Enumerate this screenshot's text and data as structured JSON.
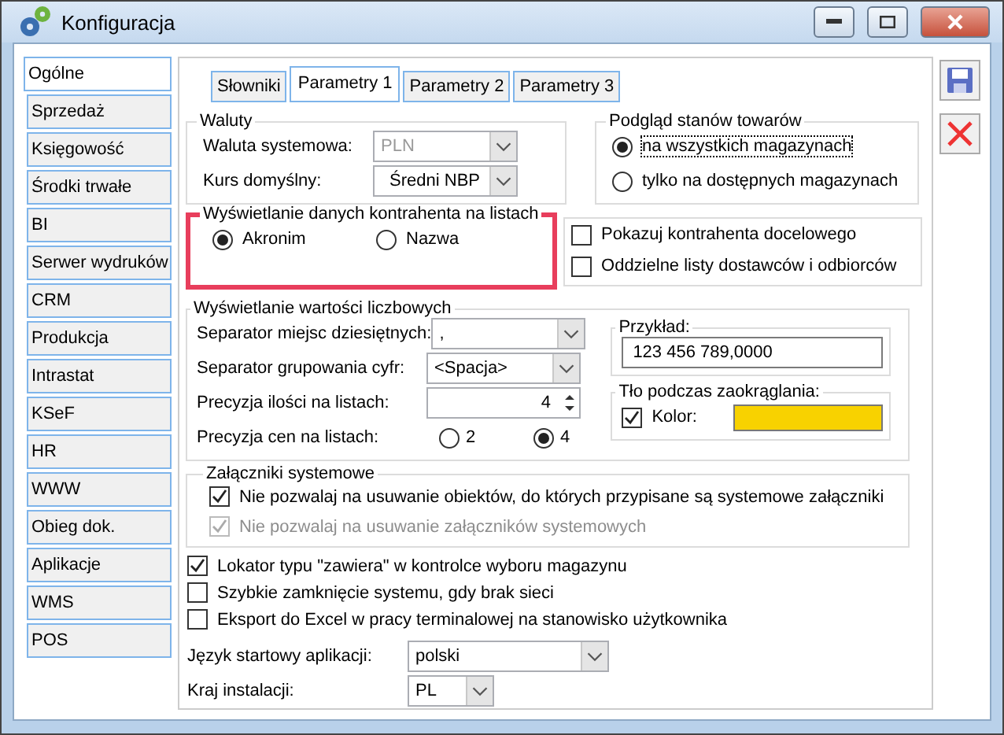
{
  "window": {
    "title": "Konfiguracja"
  },
  "sidebar": {
    "items": [
      {
        "label": "Ogólne",
        "selected": true
      },
      {
        "label": "Sprzedaż",
        "selected": false
      },
      {
        "label": "Księgowość",
        "selected": false
      },
      {
        "label": "Środki trwałe",
        "selected": false
      },
      {
        "label": "BI",
        "selected": false
      },
      {
        "label": "Serwer wydruków",
        "selected": false
      },
      {
        "label": "CRM",
        "selected": false
      },
      {
        "label": "Produkcja",
        "selected": false
      },
      {
        "label": "Intrastat",
        "selected": false
      },
      {
        "label": "KSeF",
        "selected": false
      },
      {
        "label": "HR",
        "selected": false
      },
      {
        "label": "WWW",
        "selected": false
      },
      {
        "label": "Obieg dok.",
        "selected": false
      },
      {
        "label": "Aplikacje",
        "selected": false
      },
      {
        "label": "WMS",
        "selected": false
      },
      {
        "label": "POS",
        "selected": false
      }
    ]
  },
  "tabs": [
    {
      "label": "Słowniki",
      "selected": false
    },
    {
      "label": "Parametry 1",
      "selected": true
    },
    {
      "label": "Parametry 2",
      "selected": false
    },
    {
      "label": "Parametry 3",
      "selected": false
    }
  ],
  "currency": {
    "title": "Waluty",
    "fields": [
      {
        "label": "Waluta systemowa:",
        "value": "PLN",
        "disabled": true
      },
      {
        "label": "Kurs domyślny:",
        "value": "Średni NBP",
        "disabled": false
      }
    ]
  },
  "stock_preview": {
    "title": "Podgląd stanów towarów",
    "options": [
      {
        "label": "na wszystkich magazynach",
        "selected": true
      },
      {
        "label": "tylko na dostępnych magazynach",
        "selected": false
      }
    ]
  },
  "contractor_display": {
    "title": "Wyświetlanie danych kontrahenta na listach",
    "highlighted": true,
    "options": [
      {
        "label": "Akronim",
        "selected": true
      },
      {
        "label": "Nazwa",
        "selected": false
      }
    ]
  },
  "contractor_checks": [
    {
      "label": "Pokazuj kontrahenta docelowego",
      "checked": false
    },
    {
      "label": "Oddzielne listy dostawców i odbiorców",
      "checked": false
    }
  ],
  "numbers": {
    "title": "Wyświetlanie wartości liczbowych",
    "decimal_separator": {
      "label": "Separator miejsc dziesiętnych:",
      "value": ","
    },
    "grouping": {
      "label": "Separator grupowania cyfr:",
      "value": "<Spacja>"
    },
    "quantity_precision": {
      "label": "Precyzja ilości na listach:",
      "value": "4"
    },
    "price_precision": {
      "label": "Precyzja cen na listach:",
      "options": [
        {
          "label": "2",
          "selected": false
        },
        {
          "label": "4",
          "selected": true
        }
      ]
    }
  },
  "example": {
    "title": "Przykład:",
    "value": "123 456 789,0000"
  },
  "rounding": {
    "title": "Tło podczas zaokrąglania:",
    "label": "Kolor:",
    "checked": true,
    "color": "#f8d200"
  },
  "attachments": {
    "title": "Załączniki systemowe",
    "checks": [
      {
        "label": "Nie pozwalaj na usuwanie obiektów, do których przypisane są systemowe załączniki",
        "checked": true,
        "disabled": false
      },
      {
        "label": "Nie pozwalaj na usuwanie załączników systemowych",
        "checked": true,
        "disabled": true
      }
    ]
  },
  "options": [
    {
      "label": "Lokator typu \"zawiera\" w kontrolce wyboru magazynu",
      "checked": true
    },
    {
      "label": "Szybkie zamknięcie systemu, gdy brak sieci",
      "checked": false
    },
    {
      "label": "Eksport do Excel w pracy terminalowej na stanowisko użytkownika",
      "checked": false
    }
  ],
  "language": {
    "label": "Język startowy aplikacji:",
    "value": "polski"
  },
  "country": {
    "label": "Kraj instalacji:",
    "value": "PL"
  }
}
